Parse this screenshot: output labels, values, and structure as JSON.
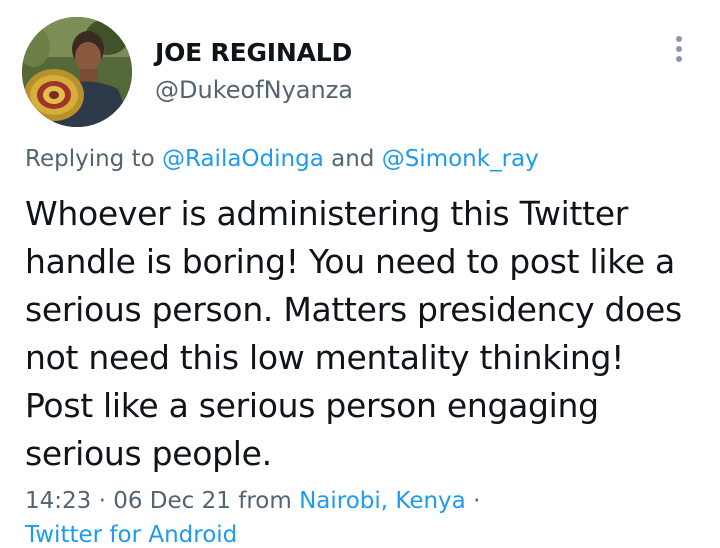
{
  "author": {
    "display_name": "JOE REGINALD",
    "handle": "@DukeofNyanza",
    "avatar_icon": "profile-photo-avatar"
  },
  "more_icon": "more-options-icon",
  "reply": {
    "prefix": "Replying to ",
    "mention_1": "@RailaOdinga",
    "conjunction": " and ",
    "mention_2": "@Simonk_ray"
  },
  "tweet_lines": [
    "Whoever is administering this Twitter",
    "handle is boring! You need to post like a",
    "serious person. Matters presidency does",
    "not need this low mentality thinking!",
    "Post like a serious person engaging",
    "serious people."
  ],
  "meta": {
    "time": "14:23",
    "separator_1": " · ",
    "date": "06 Dec 21",
    "from_word": " from ",
    "location": "Nairobi, Kenya",
    "separator_2": " ·",
    "source": "Twitter for Android"
  },
  "colors": {
    "text": "#0f1419",
    "secondary": "#536471",
    "link": "#1d9bf0"
  }
}
